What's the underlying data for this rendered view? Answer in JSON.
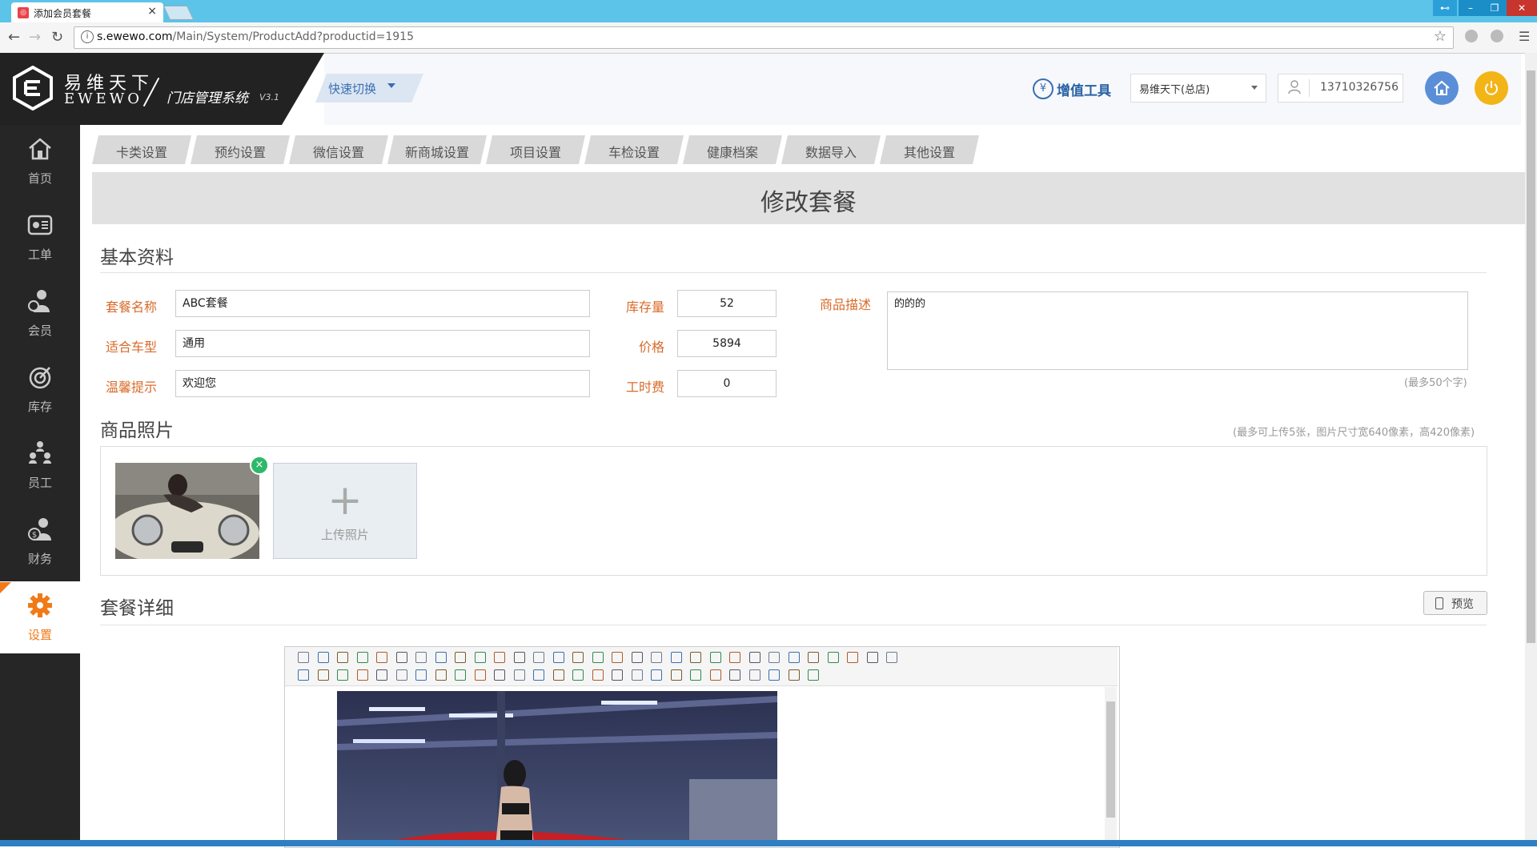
{
  "browser": {
    "tab_title": "添加会员套餐",
    "tab_close": "×",
    "url_host": "s.ewewo.com",
    "url_path": "/Main/System/ProductAdd?productid=1915",
    "star": "☆"
  },
  "brand": {
    "name_cn": "易维天下",
    "name_en": "EWEWO",
    "system_name": "门店管理系统",
    "version": "V3.1"
  },
  "header": {
    "quick_switch": "快速切换",
    "add_tools": "增值工具",
    "store_select": "易维天下(总店)",
    "user_phone": "13710326756",
    "yen_glyph": "¥"
  },
  "sidebar": {
    "items": [
      {
        "label": "首页",
        "icon": "home-icon"
      },
      {
        "label": "工单",
        "icon": "work-order-icon"
      },
      {
        "label": "会员",
        "icon": "member-icon"
      },
      {
        "label": "库存",
        "icon": "inventory-icon"
      },
      {
        "label": "员工",
        "icon": "staff-icon"
      },
      {
        "label": "财务",
        "icon": "finance-icon"
      },
      {
        "label": "设置",
        "icon": "settings-icon"
      }
    ],
    "active": "设置"
  },
  "settings_tabs": [
    "卡类设置",
    "预约设置",
    "微信设置",
    "新商城设置",
    "项目设置",
    "车检设置",
    "健康档案",
    "数据导入",
    "其他设置"
  ],
  "page": {
    "title": "修改套餐",
    "basic_info_title": "基本资料",
    "fields": {
      "package_name_label": "套餐名称",
      "package_name_value": "ABC套餐",
      "car_type_label": "适合车型",
      "car_type_value": "通用",
      "tip_label": "温馨提示",
      "tip_value": "欢迎您",
      "stock_label": "库存量",
      "stock_value": "52",
      "price_label": "价格",
      "price_value": "5894",
      "labor_label": "工时费",
      "labor_value": "0",
      "desc_label": "商品描述",
      "desc_value": "的的的",
      "desc_hint": "(最多50个字)"
    },
    "photos_title": "商品照片",
    "photos_hint": "(最多可上传5张，图片尺寸宽640像素，高420像素)",
    "upload_label": "上传照片",
    "upload_plus": "+",
    "delete_glyph": "×",
    "details_title": "套餐详细",
    "preview_label": "预览"
  },
  "colors": {
    "accent": "#f07a18",
    "label_orange": "#d86b2a",
    "sidebar_bg": "#262626",
    "tabstrip": "#5bc4e8",
    "link_blue": "#2b63a6",
    "home_btn": "#5a8fd8",
    "power_btn": "#f2b417",
    "delete_green": "#2eb86a"
  }
}
